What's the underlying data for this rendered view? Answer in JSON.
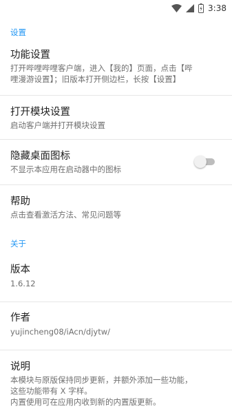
{
  "status_bar": {
    "time": "3:38",
    "icons": [
      "wifi-icon",
      "signal-icon",
      "battery-charging-icon"
    ]
  },
  "categories": {
    "settings": "设置",
    "about": "关于"
  },
  "prefs": {
    "function_settings": {
      "title": "功能设置",
      "summary_line1": "打开哔哩哔哩客户端，进入【我的】页面，点击【哔",
      "summary_line2": "哩漫游设置】；旧版本打开侧边栏，长按【设置】"
    },
    "open_module": {
      "title": "打开模块设置",
      "summary": "启动客户端并打开模块设置"
    },
    "hide_icon": {
      "title": "隐藏桌面图标",
      "summary": "不显示本应用在启动器中的图标",
      "enabled": false
    },
    "help": {
      "title": "帮助",
      "summary": "点击查看激活方法、常见问题等"
    },
    "version": {
      "title": "版本",
      "summary": "1.6.12"
    },
    "author": {
      "title": "作者",
      "summary": "yujincheng08/iAcn/djytw/"
    },
    "description": {
      "title": "说明",
      "summary_line1": "本模块与原版保持同步更新，并额外添加一些功能，",
      "summary_line2": "这些功能带有 X 字样。",
      "summary_line3": "内置使用可在应用内收到新的内置版更新。"
    }
  },
  "colors": {
    "accent": "#2196f3",
    "title_text": "#212121",
    "summary_text": "#6f6f6f",
    "divider": "#e6e6e6"
  }
}
